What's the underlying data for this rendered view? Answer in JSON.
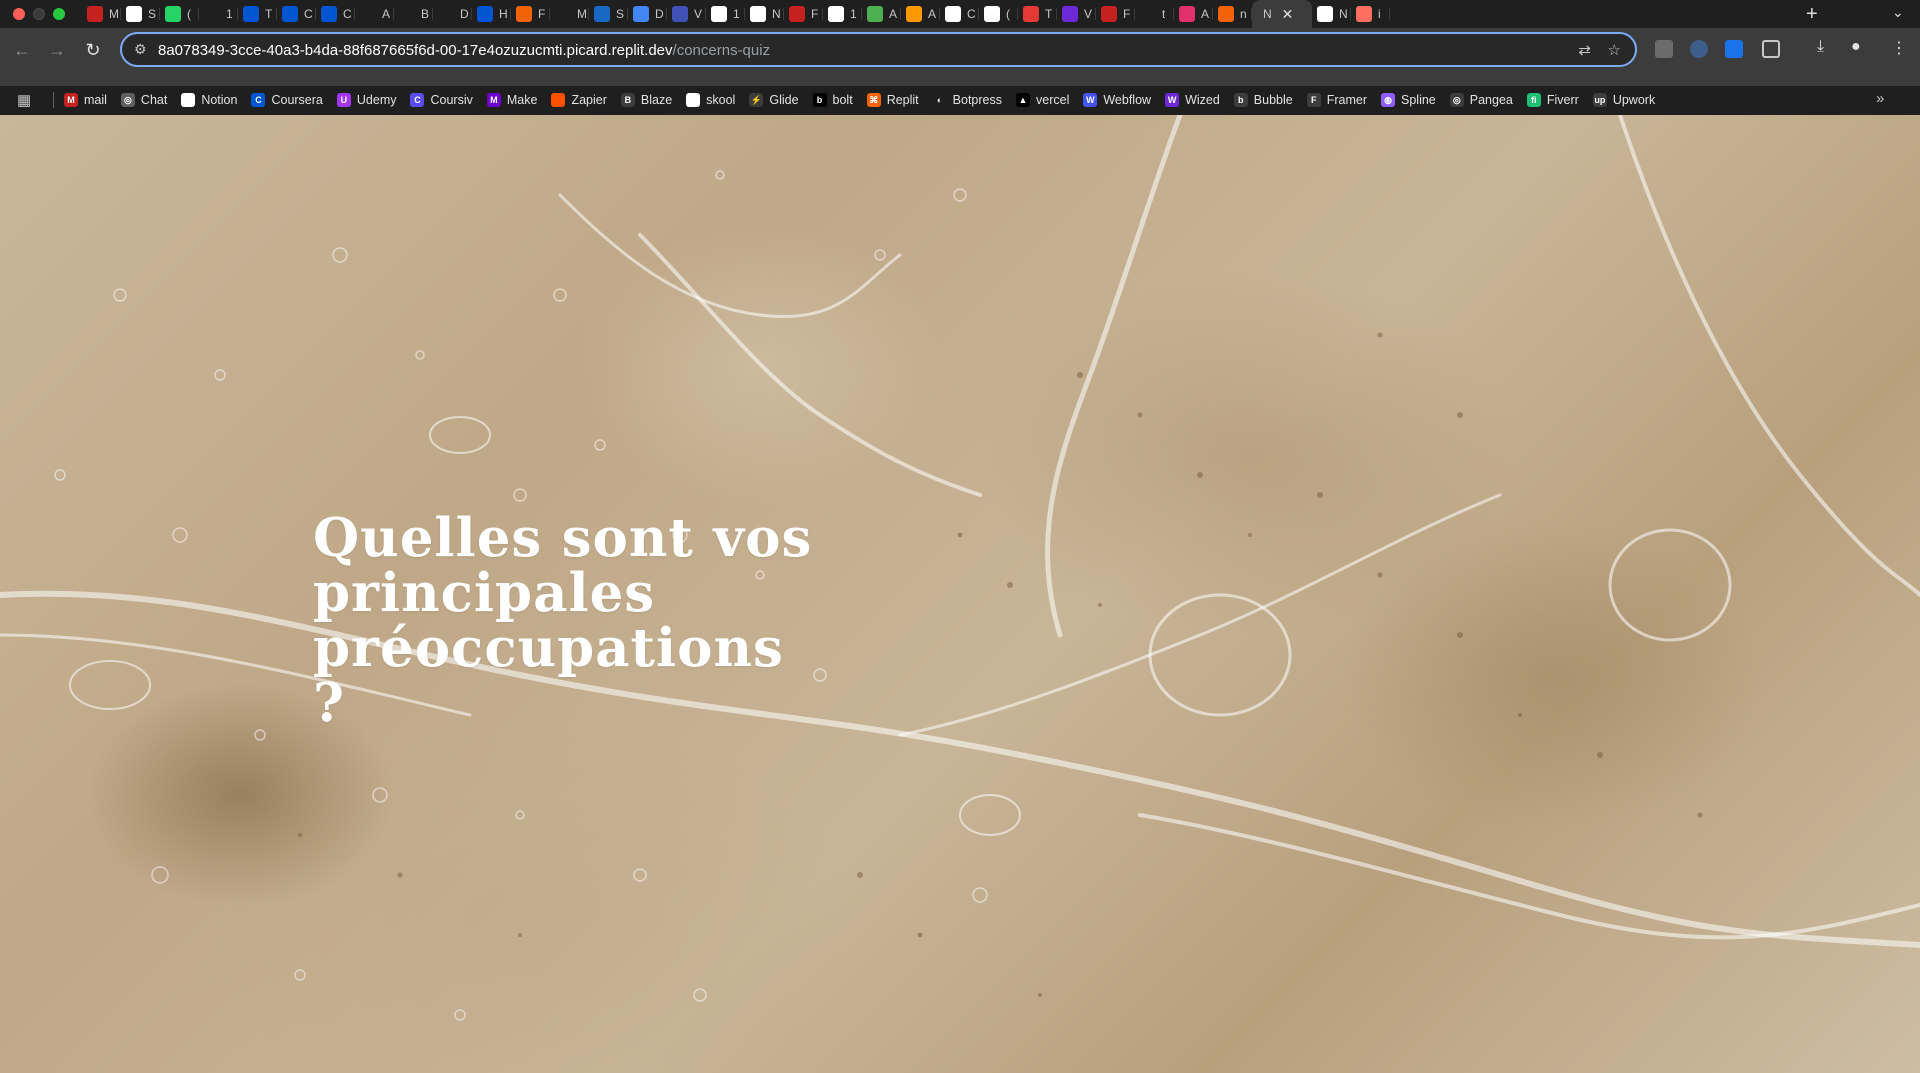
{
  "browser": {
    "tabs": [
      {
        "icon": "gmail-icon",
        "letter": "M",
        "color": "#c5221f"
      },
      {
        "icon": "notion-icon",
        "letter": "S",
        "color": "#ffffff"
      },
      {
        "icon": "whatsapp-icon",
        "letter": "(",
        "color": "#25d366"
      },
      {
        "icon": "bolt-icon",
        "letter": "1",
        "color": "#1f1f1f"
      },
      {
        "icon": "coursera-icon",
        "letter": "T",
        "color": "#0056d2"
      },
      {
        "icon": "coursera-icon",
        "letter": "C",
        "color": "#0056d2"
      },
      {
        "icon": "coursera-icon",
        "letter": "C",
        "color": "#0056d2"
      },
      {
        "icon": "apple-icon",
        "letter": "A",
        "color": "#1f1f1f"
      },
      {
        "icon": "share-icon",
        "letter": "B",
        "color": "#1f1f1f"
      },
      {
        "icon": "share-icon",
        "letter": "D",
        "color": "#1f1f1f"
      },
      {
        "icon": "coursera-icon",
        "letter": "H",
        "color": "#0056d2"
      },
      {
        "icon": "replit-icon",
        "letter": "F",
        "color": "#f26207"
      },
      {
        "icon": "figma-icon",
        "letter": "M",
        "color": "#1f1f1f"
      },
      {
        "icon": "vuetify-icon",
        "letter": "S",
        "color": "#1867c0"
      },
      {
        "icon": "calendar-icon",
        "letter": "D",
        "color": "#4285f4"
      },
      {
        "icon": "wizard-icon",
        "letter": "V",
        "color": "#3f51b5"
      },
      {
        "icon": "github-icon",
        "letter": "1",
        "color": "#ffffff"
      },
      {
        "icon": "heart-icon",
        "letter": "N",
        "color": "#ffffff"
      },
      {
        "icon": "gmail-icon",
        "letter": "F",
        "color": "#c5221f"
      },
      {
        "icon": "github-icon",
        "letter": "1",
        "color": "#ffffff"
      },
      {
        "icon": "wizard-hat-icon",
        "letter": "A",
        "color": "#4caf50"
      },
      {
        "icon": "wizard-hat-icon",
        "letter": "A",
        "color": "#ff9800"
      },
      {
        "icon": "openai-icon",
        "letter": "C",
        "color": "#ffffff"
      },
      {
        "icon": "tiktok-icon",
        "letter": "(",
        "color": "#ffffff"
      },
      {
        "icon": "t-icon",
        "letter": "T",
        "color": "#e53935"
      },
      {
        "icon": "wized-icon",
        "letter": "V",
        "color": "#6d28d9"
      },
      {
        "icon": "gmail-icon",
        "letter": "F",
        "color": "#c5221f"
      },
      {
        "icon": "circle-icon",
        "letter": "t",
        "color": "#1f1f1f"
      },
      {
        "icon": "instagram-icon",
        "letter": "A",
        "color": "#e1306c"
      },
      {
        "icon": "replit-icon",
        "letter": "n",
        "color": "#f26207"
      }
    ],
    "active_tab": {
      "letter": "N",
      "close": "✕"
    },
    "after_tabs": [
      {
        "icon": "heart-icon",
        "letter": "N",
        "color": "#ffffff"
      },
      {
        "icon": "heart-gradient-icon",
        "letter": "i",
        "color": "#ff6f61"
      }
    ],
    "url_host": "8a078349-3cce-40a3-b4da-88f687665f6d-00-17e4ozuzucmti.picard.replit.dev",
    "url_path": "/concerns-quiz",
    "bookmarks": [
      {
        "label": "mail",
        "icon": "gmail-icon",
        "color": "#c5221f",
        "letter": "M"
      },
      {
        "label": "Chat",
        "icon": "openai-icon",
        "color": "#5f5f5f",
        "letter": "◎"
      },
      {
        "label": "Notion",
        "icon": "notion-icon",
        "color": "#ffffff",
        "letter": "N"
      },
      {
        "label": "Coursera",
        "icon": "coursera-icon",
        "color": "#0056d2",
        "letter": "C"
      },
      {
        "label": "Udemy",
        "icon": "udemy-icon",
        "color": "#a435f0",
        "letter": "U"
      },
      {
        "label": "Coursiv",
        "icon": "coursiv-icon",
        "color": "#5b4cf0",
        "letter": "C"
      },
      {
        "label": "Make",
        "icon": "make-icon",
        "color": "#6d00cc",
        "letter": "M"
      },
      {
        "label": "Zapier",
        "icon": "zapier-icon",
        "color": "#ff4f00",
        "letter": " "
      },
      {
        "label": "Blaze",
        "icon": "blaze-icon",
        "color": "#3c3c3c",
        "letter": "B"
      },
      {
        "label": "skool",
        "icon": "skool-icon",
        "color": "#ffffff",
        "letter": "sk"
      },
      {
        "label": "Glide",
        "icon": "glide-icon",
        "color": "#3c3c3c",
        "letter": "⚡"
      },
      {
        "label": "bolt",
        "icon": "bolt-icon",
        "color": "#000000",
        "letter": "b"
      },
      {
        "label": "Replit",
        "icon": "replit-icon",
        "color": "#f26207",
        "letter": "⌘"
      },
      {
        "label": "Botpress",
        "icon": "botpress-icon",
        "color": "#1f1f1f",
        "letter": "◐"
      },
      {
        "label": "vercel",
        "icon": "vercel-icon",
        "color": "#000000",
        "letter": "▲"
      },
      {
        "label": "Webflow",
        "icon": "webflow-icon",
        "color": "#4353ff",
        "letter": "W"
      },
      {
        "label": "Wized",
        "icon": "wized-icon",
        "color": "#6d28d9",
        "letter": "W"
      },
      {
        "label": "Bubble",
        "icon": "bubble-icon",
        "color": "#3c3c3c",
        "letter": "b"
      },
      {
        "label": "Framer",
        "icon": "framer-icon",
        "color": "#3c3c3c",
        "letter": "F"
      },
      {
        "label": "Spline",
        "icon": "spline-icon",
        "color": "#8b5cf6",
        "letter": "◍"
      },
      {
        "label": "Pangea",
        "icon": "globe-icon",
        "color": "#3c3c3c",
        "letter": "◎"
      },
      {
        "label": "Fiverr",
        "icon": "fiverr-icon",
        "color": "#1dbf73",
        "letter": "fi"
      },
      {
        "label": "Upwork",
        "icon": "upwork-icon",
        "color": "#3c3c3c",
        "letter": "up"
      }
    ]
  },
  "page": {
    "title": "Quelles sont vos principales préoccupations ?"
  }
}
